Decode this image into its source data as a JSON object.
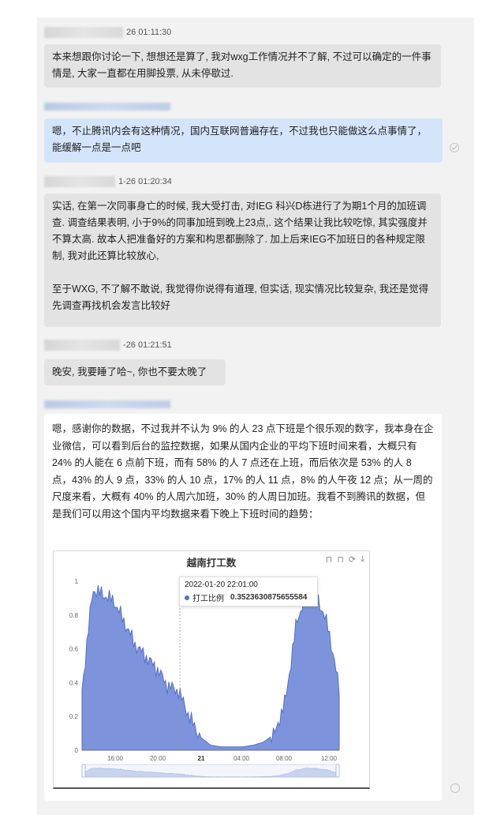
{
  "messages": [
    {
      "time": "26 01:11:30",
      "text": "本来想跟你讨论一下, 想想还是算了, 我对wxg工作情况并不了解, 不过可以确定的一件事情是, 大家一直都在用脚投票, 从未停歇过."
    },
    {
      "text": "嗯，不止腾讯内会有这种情况，国内互联网普遍存在，不过我也只能做这么点事情了，能缓解一点是一点吧"
    },
    {
      "time": "1-26 01:20:34",
      "text": "实话, 在第一次同事身亡的时候, 我大受打击, 对IEG 科兴D栋进行了为期1个月的加班调查. 调查结果表明, 小于9%的同事加班到晚上23点,. 这个结果让我比较吃惊, 其实强度并不算太高. 故本人把准备好的方案和构思都删除了. 加上后来IEG不加班日的各种规定限制, 我对此还算比较放心,",
      "text2": "至于WXG, 不了解不敢说, 我觉得你说得有道理, 但实话, 现实情况比较复杂, 我还是觉得先调查再找机会发言比较好"
    },
    {
      "time": "-26 01:21:51",
      "text": "晚安, 我要睡了哈~, 你也不要太晚了"
    },
    {
      "text": "嗯，感谢你的数据，不过我并不认为 9% 的人 23 点下班是个很乐观的数字，我本身在企业微信，可以看到后台的监控数据，如果从国内企业的平均下班时间来看，大概只有 24% 的人能在 6 点前下班，而有 58% 的人 7 点还在上班，而后依次是 53% 的人 8 点，43% 的人 9 点，33% 的人 10 点，17% 的人 11 点，8% 的人午夜 12 点；从一周的尺度来看，大概有 40% 的人周六加班，30% 的人周日加班。我看不到腾讯的数据，但是我们可以用这个国内平均数据来看下晚上下班时间的趋势："
    }
  ],
  "icons": {
    "sent_status": "check-circle-icon",
    "pending_status": "circle-icon"
  },
  "chart": {
    "toolbar": [
      "⊓",
      "⊓",
      "⟳",
      "⤓"
    ],
    "tooltip": {
      "time": "2022-01-20 22:01:00",
      "series": "打工比例",
      "value": "0.3523630875655584"
    }
  },
  "colors": {
    "series": "#5470c6",
    "fill": "#7d93dc"
  },
  "chart_data": {
    "type": "area",
    "title": "越南打工数",
    "xlabel": "",
    "ylabel": "",
    "ylim": [
      0,
      1
    ],
    "yticks": [
      "0",
      "0.2",
      "0.4",
      "0.6",
      "0.8",
      "1"
    ],
    "xticks": [
      "16:00",
      "20:00",
      "21",
      "04:00",
      "08:00",
      "12:00"
    ],
    "x": [
      "13:00",
      "14:00",
      "15:00",
      "16:00",
      "17:00",
      "18:00",
      "19:00",
      "20:00",
      "21:00",
      "22:00",
      "23:00",
      "00:00",
      "01:00",
      "02:00",
      "03:00",
      "04:00",
      "05:00",
      "06:00",
      "07:00",
      "08:00",
      "09:00",
      "10:00",
      "11:00",
      "12:00",
      "13:00"
    ],
    "series": [
      {
        "name": "打工比例",
        "values": [
          0.36,
          0.95,
          0.92,
          0.88,
          0.75,
          0.62,
          0.55,
          0.48,
          0.38,
          0.35,
          0.2,
          0.08,
          0.03,
          0.02,
          0.02,
          0.02,
          0.03,
          0.05,
          0.1,
          0.3,
          0.75,
          0.95,
          0.9,
          0.72,
          0.36
        ]
      }
    ]
  }
}
